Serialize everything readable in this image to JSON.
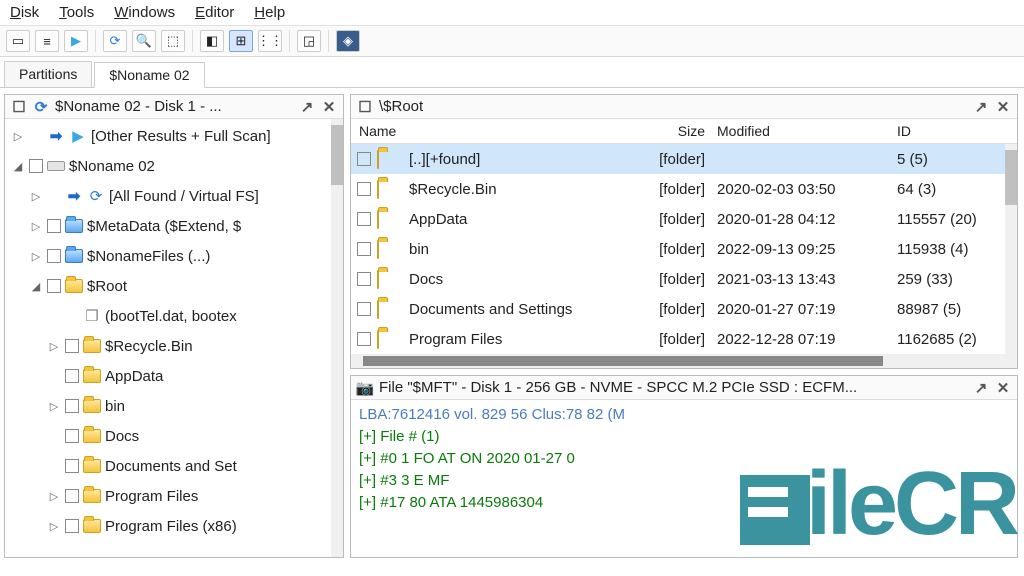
{
  "menu": [
    "Disk",
    "Tools",
    "Windows",
    "Editor",
    "Help"
  ],
  "toolbar_icons": [
    "▭",
    "≡",
    "▶",
    "⟳",
    "🔍",
    "⬚",
    "◧",
    "⊞",
    "⋮⋮",
    "⋯",
    "◲",
    "◈"
  ],
  "tabs": [
    "Partitions",
    "$Noname 02"
  ],
  "active_tab": 1,
  "left": {
    "title": "$Noname 02 - Disk 1 - ...",
    "tree": [
      {
        "d": 1,
        "exp": "▷",
        "cb": false,
        "icA": "arrow",
        "icB": "play",
        "label": "[Other Results + Full Scan]"
      },
      {
        "d": 1,
        "exp": "◢",
        "cb": true,
        "icA": "disk",
        "label": "$Noname 02"
      },
      {
        "d": 2,
        "exp": "▷",
        "cb": false,
        "icA": "arrow",
        "icB": "refresh",
        "label": "[All Found / Virtual FS]"
      },
      {
        "d": 2,
        "exp": "▷",
        "cb": true,
        "icA": "folder-blue",
        "label": "$MetaData ($Extend, $"
      },
      {
        "d": 2,
        "exp": "▷",
        "cb": true,
        "icA": "folder-blue",
        "label": "$NonameFiles (...)"
      },
      {
        "d": 2,
        "exp": "◢",
        "cb": true,
        "icA": "folder",
        "label": "$Root"
      },
      {
        "d": 3,
        "exp": "",
        "cb": false,
        "icA": "multi",
        "label": "(bootTel.dat, bootex"
      },
      {
        "d": 3,
        "exp": "▷",
        "cb": true,
        "icA": "folder",
        "label": "$Recycle.Bin"
      },
      {
        "d": 3,
        "exp": "",
        "cb": true,
        "icA": "folder",
        "label": "AppData"
      },
      {
        "d": 3,
        "exp": "▷",
        "cb": true,
        "icA": "folder",
        "label": "bin"
      },
      {
        "d": 3,
        "exp": "",
        "cb": true,
        "icA": "folder",
        "label": "Docs"
      },
      {
        "d": 3,
        "exp": "",
        "cb": true,
        "icA": "folder",
        "label": "Documents and Set"
      },
      {
        "d": 3,
        "exp": "▷",
        "cb": true,
        "icA": "folder",
        "label": "Program Files"
      },
      {
        "d": 3,
        "exp": "▷",
        "cb": true,
        "icA": "folder",
        "label": "Program Files (x86)"
      }
    ]
  },
  "list": {
    "title": "\\$Root",
    "cols": {
      "name": "Name",
      "size": "Size",
      "mod": "Modified",
      "id": "ID"
    },
    "rows": [
      {
        "sel": true,
        "name": "[..][+found]",
        "size": "[folder]",
        "mod": "",
        "id": "5 (5)"
      },
      {
        "name": "$Recycle.Bin",
        "size": "[folder]",
        "mod": "2020-02-03 03:50",
        "id": "64 (3)"
      },
      {
        "name": "AppData",
        "size": "[folder]",
        "mod": "2020-01-28 04:12",
        "id": "115557 (20)"
      },
      {
        "name": "bin",
        "size": "[folder]",
        "mod": "2022-09-13 09:25",
        "id": "115938 (4)"
      },
      {
        "name": "Docs",
        "size": "[folder]",
        "mod": "2021-03-13 13:43",
        "id": "259 (33)"
      },
      {
        "name": "Documents and Settings",
        "size": "[folder]",
        "mod": "2020-01-27 07:19",
        "id": "88987 (5)"
      },
      {
        "name": "Program Files",
        "size": "[folder]",
        "mod": "2022-12-28 07:19",
        "id": "1162685 (2)"
      }
    ]
  },
  "hex": {
    "title": "File \"$MFT\" - Disk 1 - 256 GB - NVME - SPCC M.2 PCIe SSD : ECFM...",
    "lines": [
      {
        "cls": "b",
        "t": "LBA:7612416          vol.     829  56 Clus:78  82    (M"
      },
      {
        "cls": "k",
        "t": "[+] File #               (1)"
      },
      {
        "cls": "k",
        "t": "[+] #0            1           FO AT ON   2020 01-27 0"
      },
      {
        "cls": "k",
        "t": "[+] #3            3    E    MF"
      },
      {
        "cls": "k",
        "t": "[+] #17          80    ATA      1445986304"
      }
    ]
  },
  "watermark": "ileCR"
}
